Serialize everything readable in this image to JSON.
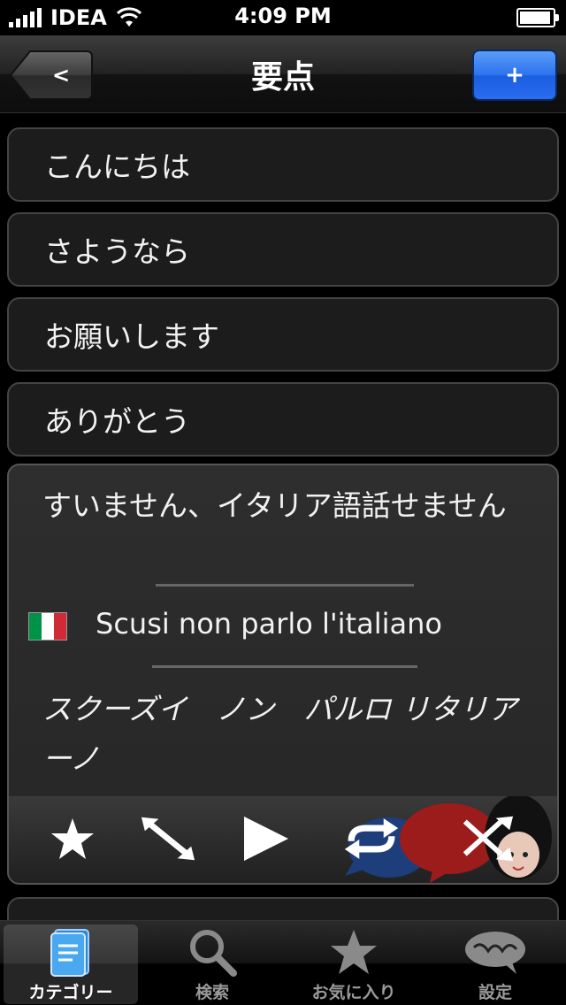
{
  "status_bar": {
    "carrier": "IDEA",
    "time": "4:09 PM"
  },
  "nav": {
    "back_label": "<",
    "title": "要点",
    "add_label": "+"
  },
  "list": {
    "rows": [
      {
        "label": "こんにちは"
      },
      {
        "label": "さようなら"
      },
      {
        "label": "お願いします"
      },
      {
        "label": "ありがとう"
      }
    ],
    "expanded": {
      "japanese": "すいません、イタリア語話せません",
      "italian": "Scusi non parlo l'italiano",
      "pronunciation": "スクーズイ　ノン　パルロ リタリアーノ",
      "flag_colors": [
        "#009246",
        "#ffffff",
        "#ce2b37"
      ],
      "actions": [
        "star-icon",
        "expand-icon",
        "play-icon",
        "repeat-icon",
        "shuffle-icon"
      ]
    }
  },
  "tab_bar": {
    "tabs": [
      {
        "label": "カテゴリー",
        "icon": "book-icon",
        "active": true
      },
      {
        "label": "検索",
        "icon": "search-icon",
        "active": false
      },
      {
        "label": "お気に入り",
        "icon": "star-icon",
        "active": false
      },
      {
        "label": "設定",
        "icon": "hola-bubble-icon",
        "active": false
      }
    ]
  },
  "colors": {
    "accent_blue": "#2c73ee",
    "background": "#000000",
    "row_background": "#1c1c1c"
  }
}
